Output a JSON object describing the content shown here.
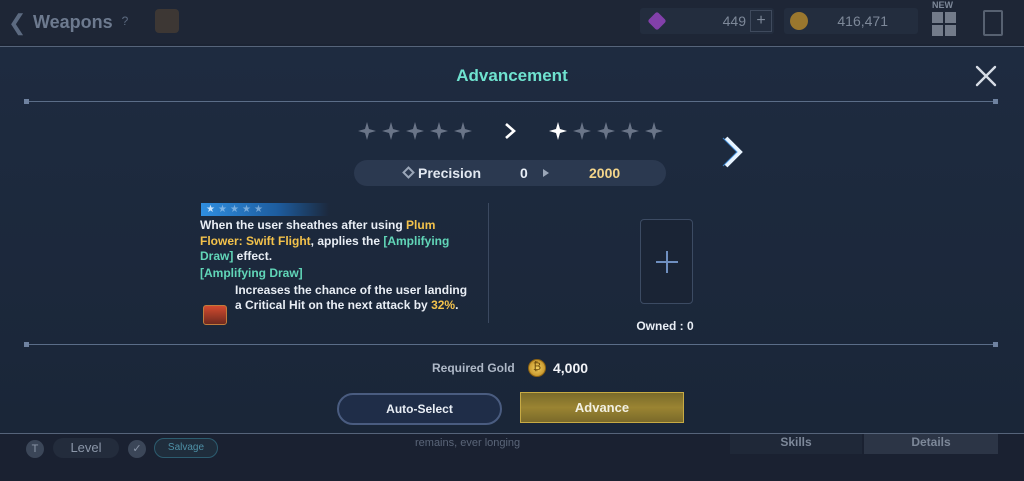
{
  "background": {
    "page_title": "Weapons",
    "help": "?",
    "currency_crystals": "449",
    "currency_gold": "416,471",
    "new_badge": "NEW",
    "level_filter": "Level",
    "salvage": "Salvage",
    "footer_text": "remains, ever longing",
    "tabs": [
      "Skills",
      "Details"
    ]
  },
  "modal": {
    "title": "Advancement",
    "stars_before_filled": 0,
    "stars_after_filled": 1,
    "stars_total": 5,
    "stat": {
      "name": "Precision",
      "old_value": "0",
      "new_value": "2000"
    },
    "skill": {
      "desc_part1": "When the user sheathes after using ",
      "desc_gold": "Plum Flower: Swift Flight",
      "desc_part2": ", applies the ",
      "desc_green": "[Amplifying Draw]",
      "desc_part3": " effect.",
      "effect_label": "[Amplifying Draw]",
      "effect_part1": "Increases the chance of the user landing a Critical Hit on the next attack by ",
      "effect_value": "32%",
      "effect_part2": "."
    },
    "owned": "Owned : 0",
    "required_gold_label": "Required Gold",
    "required_gold_value": "4,000",
    "buttons": {
      "auto_select": "Auto-Select",
      "advance": "Advance"
    }
  },
  "colors": {
    "title_accent": "#6fe2cf",
    "highlight_gold": "#f3c24b",
    "highlight_green": "#61d6b8",
    "advance_button": "#9a8432"
  }
}
